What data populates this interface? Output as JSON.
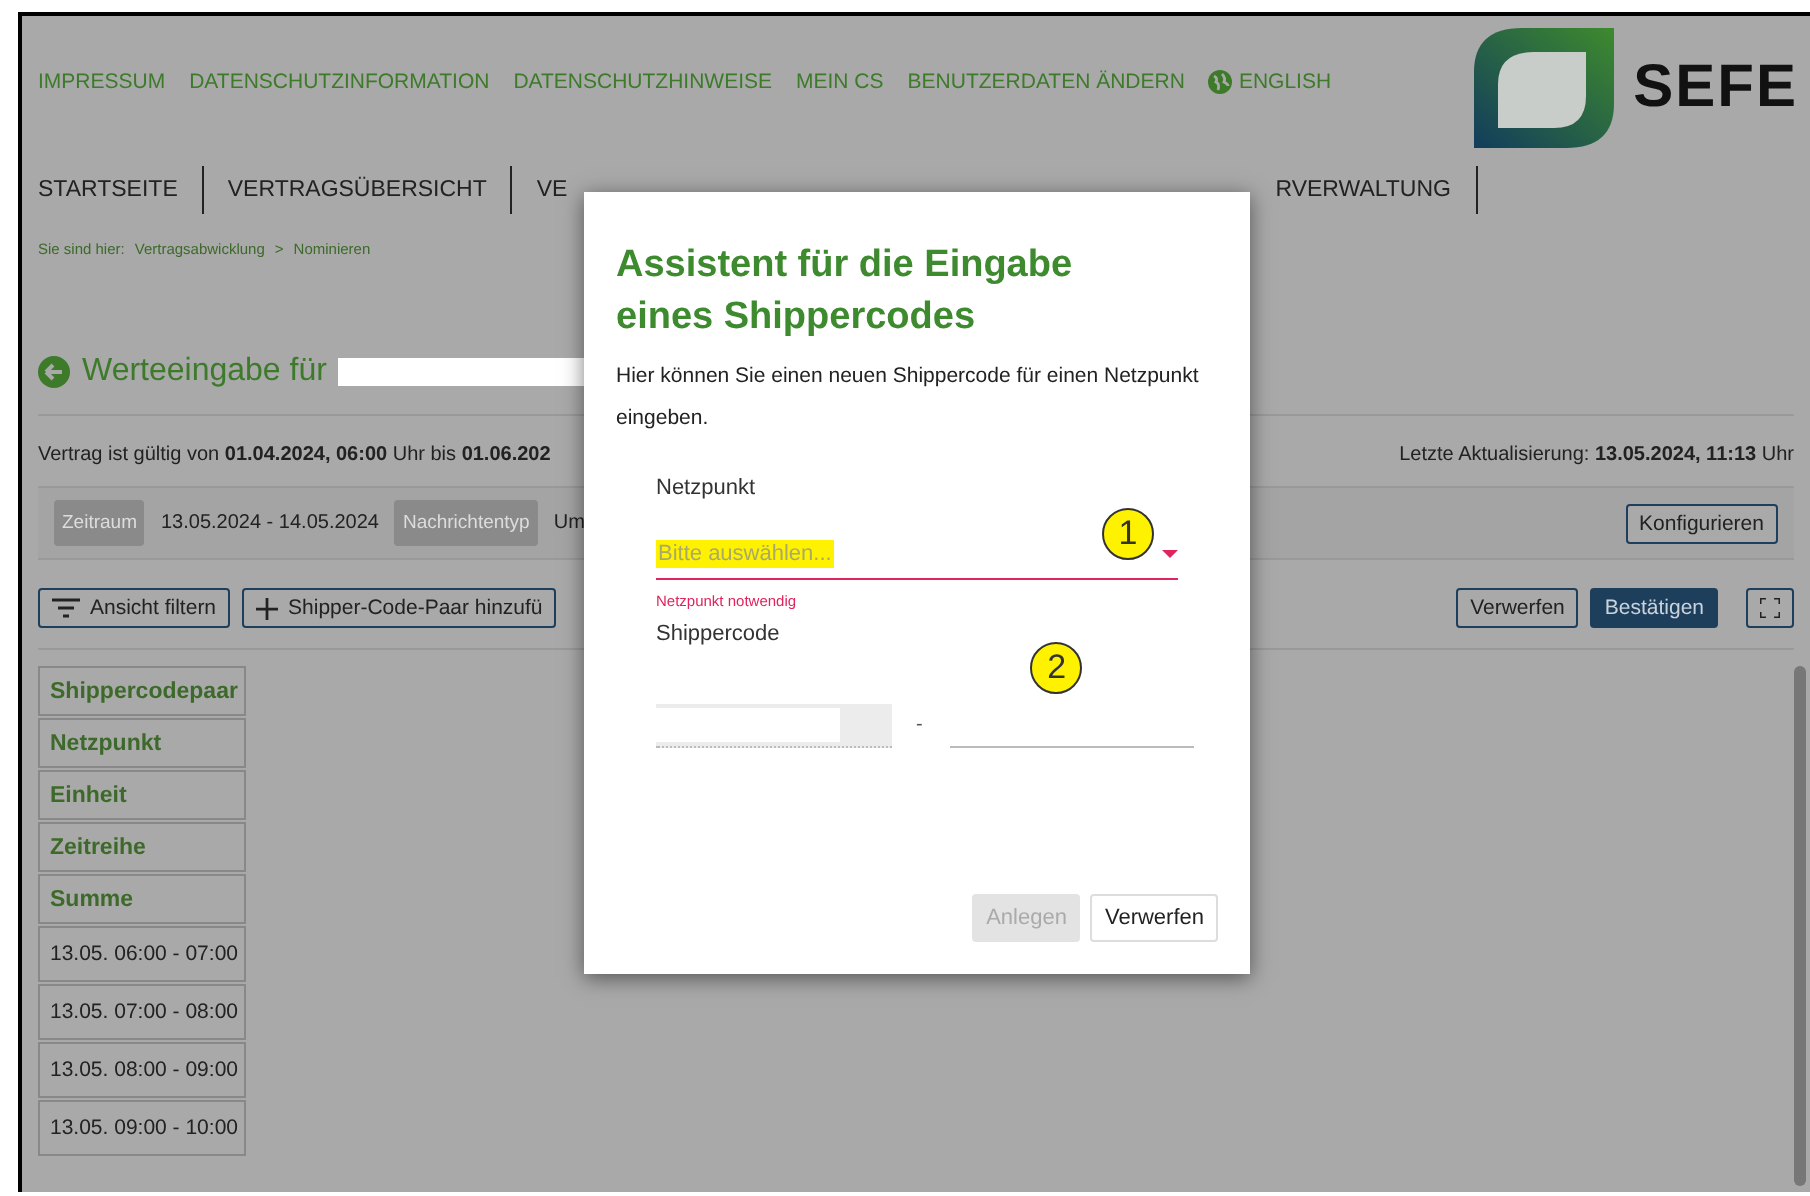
{
  "top_links": [
    "IMPRESSUM",
    "DATENSCHUTZINFORMATION",
    "DATENSCHUTZHINWEISE",
    "MEIN CS",
    "BENUTZERDATEN ÄNDERN"
  ],
  "language": "ENGLISH",
  "logo": {
    "text": "SEFE"
  },
  "nav_tabs": [
    "STARTSEITE",
    "VERTRAGSÜBERSICHT",
    "VE",
    "RVERWALTUNG"
  ],
  "breadcrumb": {
    "prefix": "Sie sind hier:",
    "items": [
      "Vertragsabwicklung",
      "Nominieren"
    ],
    "separator": ">"
  },
  "heading": "Werteeingabe für",
  "validity": "Vertrag ist gültig von **01.04.2024, 06:00** Uhr bis **01.06.202**",
  "last_update": "Letzte Aktualisierung: **13.05.2024, 11:13** Uhr",
  "filters": [
    {
      "kind": "tag",
      "text": "Zeitraum"
    },
    {
      "kind": "value",
      "text": "13.05.2024 - 14.05.2024"
    },
    {
      "kind": "tag",
      "text": "Nachrichtentyp"
    },
    {
      "kind": "value",
      "text": "Um"
    }
  ],
  "configure_button": "Konfigurieren",
  "toolbar_left": [
    "Ansicht filtern",
    "Shipper-Code-Paar hinzufü"
  ],
  "toolbar_right": [
    {
      "kind": "secondary",
      "label": "Verwerfen"
    },
    {
      "kind": "primary",
      "label": "Bestätigen"
    }
  ],
  "table_rows": [
    {
      "kind": "header",
      "text": "Shippercodepaar"
    },
    {
      "kind": "header",
      "text": "Netzpunkt"
    },
    {
      "kind": "header",
      "text": "Einheit"
    },
    {
      "kind": "header",
      "text": "Zeitreihe"
    },
    {
      "kind": "header",
      "text": "Summe"
    },
    {
      "kind": "time",
      "text": "13.05. 06:00 - 07:00"
    },
    {
      "kind": "time",
      "text": "13.05. 07:00 - 08:00"
    },
    {
      "kind": "time",
      "text": "13.05. 08:00 - 09:00"
    },
    {
      "kind": "time",
      "text": "13.05. 09:00 - 10:00"
    }
  ],
  "dialog": {
    "title": "Assistent für die Eingabe eines Shippercodes",
    "description": "Hier können Sie einen neuen Shippercode für einen Netzpunkt eingeben.",
    "netzpunkt_label": "Netzpunkt",
    "netzpunkt_placeholder": "Bitte auswählen...",
    "netzpunkt_error": "Netzpunkt notwendig",
    "shippercode_label": "Shippercode",
    "separator": "-",
    "annotations": [
      "1",
      "2"
    ],
    "buttons": [
      {
        "label": "Anlegen",
        "disabled": true
      },
      {
        "label": "Verwerfen",
        "disabled": false
      }
    ]
  }
}
